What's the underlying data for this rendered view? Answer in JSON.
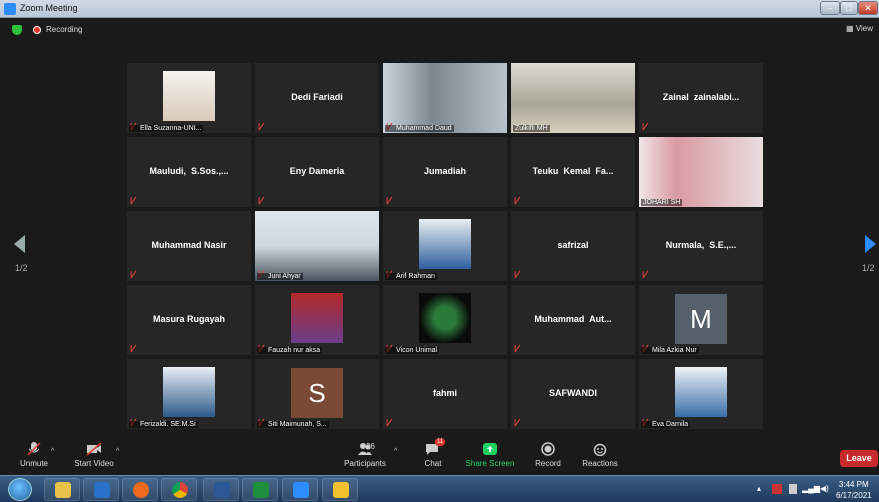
{
  "window": {
    "title": "Zoom Meeting",
    "min": "–",
    "max": "□",
    "close": "✕"
  },
  "topbar": {
    "recording": "Recording",
    "view": "View"
  },
  "nav": {
    "page_left": "1/2",
    "page_right": "1/2"
  },
  "participants_grid": [
    {
      "id": "ella",
      "label": "Ella Suzanna-UNI...",
      "type": "photo",
      "muted": true
    },
    {
      "id": "dedi",
      "name": "Dedi Fariadi",
      "type": "name",
      "muted": true
    },
    {
      "id": "daud",
      "label": "Muhammad Daud",
      "type": "video",
      "muted": true
    },
    {
      "id": "zulkifli",
      "label": "Zulkifli MH",
      "type": "video",
      "active": true
    },
    {
      "id": "zainal",
      "name": "Zainal  zainalabi...",
      "type": "name",
      "muted": true
    },
    {
      "id": "mauludi",
      "name": "Mauludi,  S.Sos.,...",
      "type": "name",
      "muted": true
    },
    {
      "id": "eny",
      "name": "Eny Dameria",
      "type": "name",
      "muted": true
    },
    {
      "id": "jumadiah",
      "name": "Jumadiah",
      "type": "name",
      "muted": true
    },
    {
      "id": "teuku",
      "name": "Teuku  Kemal  Fa...",
      "type": "name",
      "muted": true
    },
    {
      "id": "johari",
      "label": "JOHARI SH",
      "type": "video"
    },
    {
      "id": "nasir",
      "name": "Muhammad Nasir",
      "type": "name",
      "muted": true
    },
    {
      "id": "juni",
      "label": "Juni Ahyar",
      "type": "video",
      "muted": true
    },
    {
      "id": "arif",
      "label": "Arif Rahman",
      "type": "photo",
      "muted": true
    },
    {
      "id": "safrizal",
      "name": "safrizal",
      "type": "name",
      "muted": true
    },
    {
      "id": "nurmala",
      "name": "Nurmala,  S.E.,...",
      "type": "name",
      "muted": true
    },
    {
      "id": "masura",
      "name": "Masura Rugayah",
      "type": "name",
      "muted": true
    },
    {
      "id": "fauzah",
      "label": "Fauzah nur aksa",
      "type": "photo",
      "muted": true
    },
    {
      "id": "vicon",
      "label": "Vicon Unimal",
      "type": "logo",
      "muted": true
    },
    {
      "id": "aut",
      "name": "Muhammad  Aut...",
      "type": "name",
      "muted": true
    },
    {
      "id": "mila",
      "label": "Mila Azkia Nur",
      "type": "letter",
      "letter": "M",
      "muted": true
    },
    {
      "id": "ferizaldi",
      "label": "Ferizaldi. SE.M.Si",
      "type": "photo",
      "muted": true
    },
    {
      "id": "siti",
      "label": "Siti Maimunah, S...",
      "type": "letter",
      "letter": "S",
      "muted": true
    },
    {
      "id": "fahmi",
      "name": "fahmi",
      "type": "name",
      "muted": true
    },
    {
      "id": "safwandi",
      "name": "SAFWANDI",
      "type": "name",
      "muted": true
    },
    {
      "id": "eva",
      "label": "Eva Darnila",
      "type": "photo",
      "muted": true
    }
  ],
  "toolbar": {
    "unmute": "Unmute",
    "start_video": "Start Video",
    "participants_count": "26",
    "participants": "Participants",
    "chat_badge": "11",
    "chat": "Chat",
    "share_screen": "Share Screen",
    "record": "Record",
    "reactions": "Reactions",
    "leave": "Leave"
  },
  "taskbar": {
    "time": "3:44 PM",
    "date": "6/17/2021"
  },
  "colors": {
    "accent": "#2d8cff",
    "share": "#1fd161",
    "leave": "#c92b2b",
    "active_border": "#c6e36a"
  }
}
